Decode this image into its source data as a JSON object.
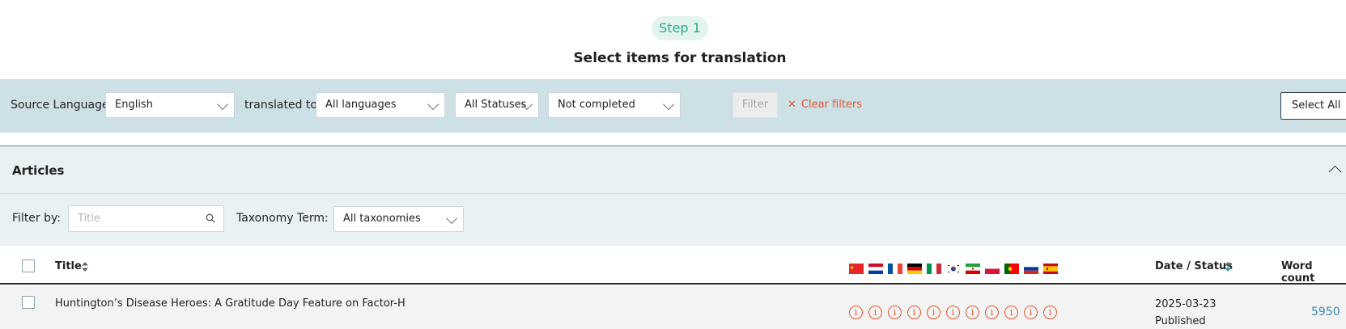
{
  "step": {
    "badge": "Step 1",
    "title": "Select items for translation"
  },
  "filter_bar": {
    "source_language_label": "Source Language:",
    "source_language_value": "English",
    "translated_to_label": "translated to:",
    "target_language_value": "All languages",
    "status_value": "All Statuses",
    "completion_value": "Not completed",
    "filter_button": "Filter",
    "clear_filters": "Clear filters",
    "select_all": "Select All"
  },
  "articles": {
    "title": "Articles",
    "filter_by_label": "Filter by:",
    "search_placeholder": "Title",
    "taxonomy_label": "Taxonomy Term:",
    "taxonomy_value": "All taxonomies"
  },
  "table": {
    "columns": {
      "title": "Title",
      "date_status": "Date / Status",
      "word_count": "Word count"
    },
    "language_flags": [
      "flag-cn",
      "flag-nl",
      "flag-fr",
      "flag-de",
      "flag-it",
      "flag-kr",
      "flag-ir",
      "flag-pl",
      "flag-pt",
      "flag-ru",
      "flag-es"
    ],
    "rows": [
      {
        "title": "Huntington’s Disease Heroes: A Gratitude Day Feature on Factor-H",
        "translation_status_icon": "info-circle-icon",
        "date": "2025-03-23",
        "status": "Published",
        "word_count": "5950"
      }
    ]
  },
  "colors": {
    "accent_orange": "#e2582d",
    "filter_bar_bg": "#cde0e6",
    "step_green": "#2cab88",
    "link_blue": "#3b86b0"
  }
}
